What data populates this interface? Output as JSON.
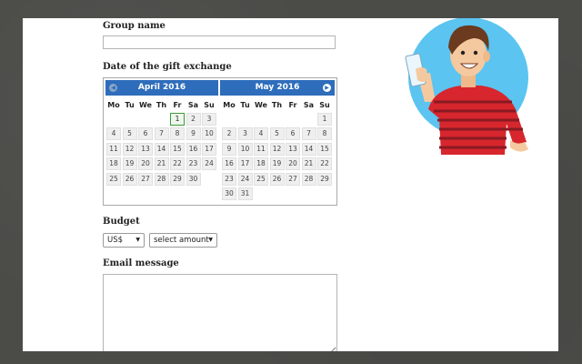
{
  "form": {
    "group_name_label": "Group name",
    "group_name_value": "",
    "date_label": "Date of the gift exchange",
    "budget_label": "Budget",
    "currency_selected": "US$",
    "amount_selected": "select amount",
    "email_label": "Email message",
    "email_value": ""
  },
  "calendar": {
    "weekdays": [
      "Mo",
      "Tu",
      "We",
      "Th",
      "Fr",
      "Sa",
      "Su"
    ],
    "months": [
      {
        "title": "April 2016",
        "rows": [
          [
            "",
            "",
            "",
            "",
            "1",
            "2",
            "3"
          ],
          [
            "4",
            "5",
            "6",
            "7",
            "8",
            "9",
            "10"
          ],
          [
            "11",
            "12",
            "13",
            "14",
            "15",
            "16",
            "17"
          ],
          [
            "18",
            "19",
            "20",
            "21",
            "22",
            "23",
            "24"
          ],
          [
            "25",
            "26",
            "27",
            "28",
            "29",
            "30",
            ""
          ]
        ],
        "selected": "1"
      },
      {
        "title": "May 2016",
        "rows": [
          [
            "",
            "",
            "",
            "",
            "",
            "",
            "1"
          ],
          [
            "2",
            "3",
            "4",
            "5",
            "6",
            "7",
            "8"
          ],
          [
            "9",
            "10",
            "11",
            "12",
            "13",
            "14",
            "15"
          ],
          [
            "16",
            "17",
            "18",
            "19",
            "20",
            "21",
            "22"
          ],
          [
            "23",
            "24",
            "25",
            "26",
            "27",
            "28",
            "29"
          ],
          [
            "30",
            "31",
            "",
            "",
            "",
            "",
            ""
          ]
        ],
        "selected": ""
      }
    ]
  },
  "icons": {
    "prev": "chevron-left-icon",
    "next": "chevron-right-icon",
    "dropdown": "caret-down-icon"
  },
  "colors": {
    "calendar_header": "#2e6dbb",
    "selected_border": "#3a9a3a",
    "illustration_circle": "#5bc4f0",
    "shirt": "#d7262d"
  }
}
